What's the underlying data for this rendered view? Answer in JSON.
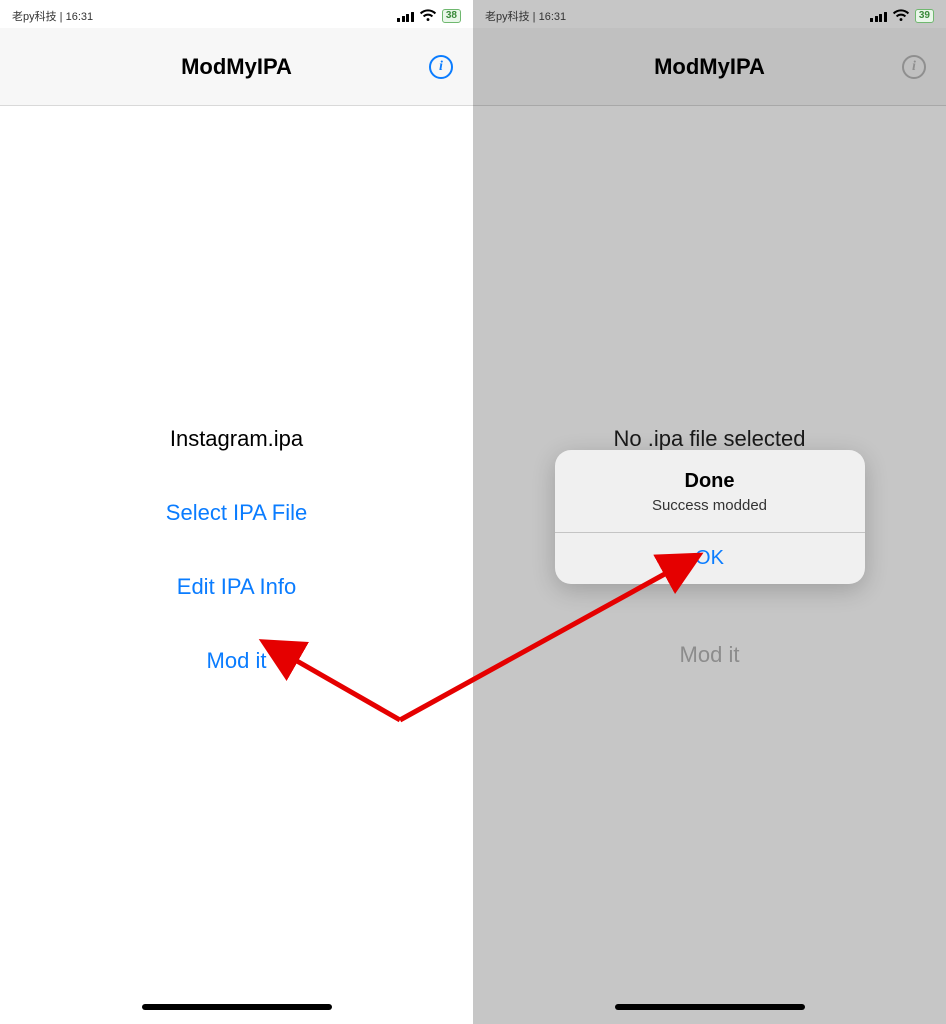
{
  "left": {
    "status": {
      "carrier_time": "老py科技 | 16:31",
      "battery": "38"
    },
    "nav": {
      "title": "ModMyIPA"
    },
    "main": {
      "file_label": "Instagram.ipa",
      "select_btn": "Select IPA File",
      "edit_btn": "Edit IPA Info",
      "mod_btn": "Mod it"
    }
  },
  "right": {
    "status": {
      "carrier_time": "老py科技 | 16:31",
      "battery": "39"
    },
    "nav": {
      "title": "ModMyIPA"
    },
    "main": {
      "file_label": "No .ipa file selected",
      "mod_btn": "Mod it"
    },
    "alert": {
      "title": "Done",
      "message": "Success modded",
      "ok": "OK"
    }
  }
}
